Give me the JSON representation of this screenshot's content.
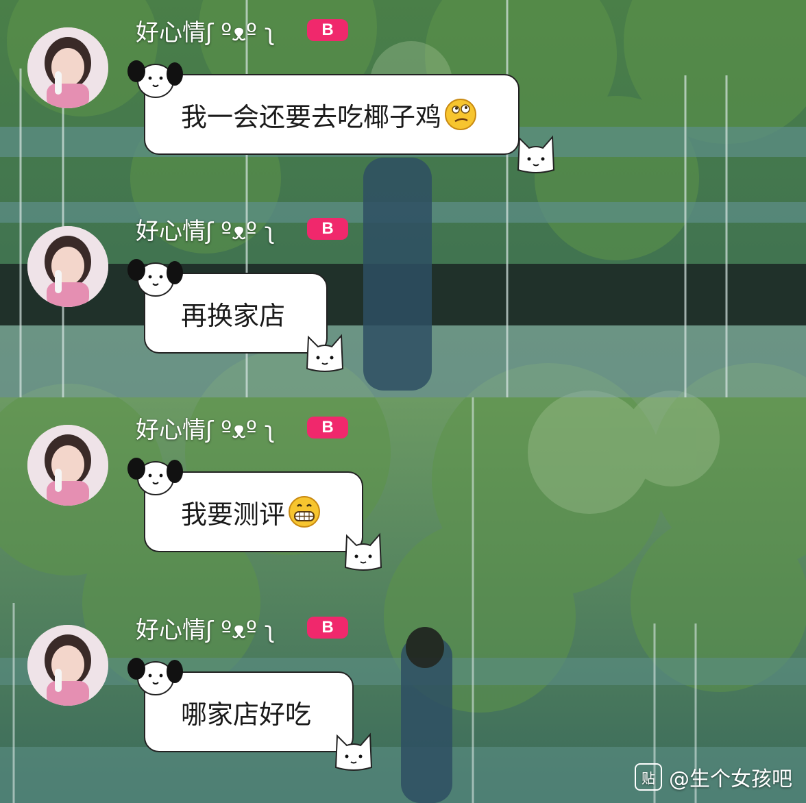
{
  "sender": {
    "name": "好心情ʃ ºᴥº ʅ",
    "badge": "B"
  },
  "messages": [
    {
      "text": "我一会还要去吃椰子鸡",
      "emoji": "confused-face-icon"
    },
    {
      "text": "再换家店",
      "emoji": null
    },
    {
      "text": "我要测评",
      "emoji": "grinning-face-icon"
    },
    {
      "text": "哪家店好吃",
      "emoji": null
    }
  ],
  "watermark": {
    "icon_text": "贴",
    "label": "@生个女孩吧"
  },
  "colors": {
    "badge": "#f0286c",
    "bubble": "#ffffff",
    "foliage": "#4f8a45",
    "glass": "#5c8d85"
  }
}
